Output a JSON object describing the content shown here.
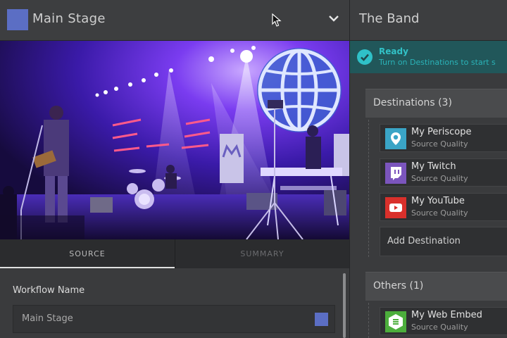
{
  "stage": {
    "title": "Main Stage",
    "color": "#5b6ec4"
  },
  "tabs": [
    {
      "label": "SOURCE",
      "active": true
    },
    {
      "label": "SUMMARY",
      "active": false
    }
  ],
  "workflow": {
    "label": "Workflow Name",
    "value": "Main Stage",
    "color": "#5b6ec4"
  },
  "band": {
    "title": "The Band"
  },
  "status": {
    "title": "Ready",
    "message": "Turn on Destinations to start s",
    "color": "#32c1c6"
  },
  "destinations": {
    "header": "Destinations (3)",
    "items": [
      {
        "name": "My Periscope",
        "quality": "Source Quality",
        "icon": "periscope-icon",
        "color": "#3aa4c6"
      },
      {
        "name": "My Twitch",
        "quality": "Source Quality",
        "icon": "twitch-icon",
        "color": "#7b55bd"
      },
      {
        "name": "My YouTube",
        "quality": "Source Quality",
        "icon": "youtube-icon",
        "color": "#d9302b"
      }
    ],
    "add_label": "Add Destination"
  },
  "others": {
    "header": "Others (1)",
    "items": [
      {
        "name": "My Web Embed",
        "quality": "Source Quality",
        "icon": "web-embed-icon",
        "color": "#4cae3c"
      }
    ]
  }
}
